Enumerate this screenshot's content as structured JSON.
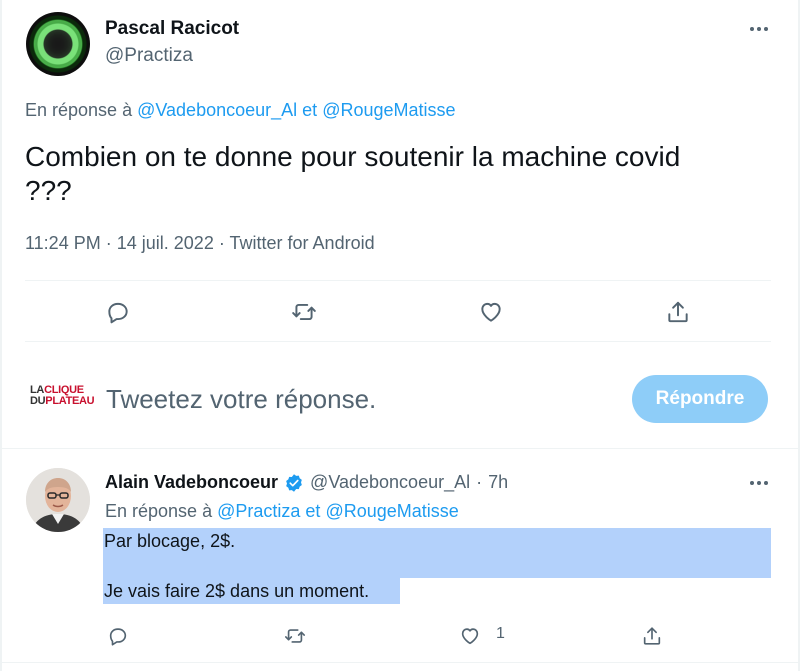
{
  "main_tweet": {
    "author_name": "Pascal Racicot",
    "author_handle": "@Practiza",
    "reply_prefix": "En réponse à",
    "reply_mentions": [
      "@Vadeboncoeur_Al",
      "@RougeMatisse"
    ],
    "reply_joiner": "et",
    "text_line1": "Combien on te donne pour soutenir la machine covid",
    "text_line2": "???",
    "time": "11:24 PM",
    "date": "14 juil. 2022",
    "source": "Twitter for Android",
    "separator": "·",
    "actions": [
      "reply-icon",
      "retweet-icon",
      "like-icon",
      "share-icon"
    ]
  },
  "compose": {
    "logo_line1_a": "LA",
    "logo_line1_b": "CLIQUE",
    "logo_line2_a": "DU",
    "logo_line2_b": "PLATEAU",
    "placeholder": "Tweetez votre réponse.",
    "reply_button": "Répondre"
  },
  "reply_tweet": {
    "author_name": "Alain Vadeboncoeur",
    "author_handle": "@Vadeboncoeur_Al",
    "separator": "·",
    "time_ago": "7h",
    "reply_prefix": "En réponse à",
    "reply_mentions": [
      "@Practiza",
      "@RougeMatisse"
    ],
    "reply_joiner": "et",
    "text_line1": "Par blocage, 2$.",
    "text_line2": "Je vais faire 2$ dans un moment.",
    "like_count": "1"
  },
  "colors": {
    "accent": "#1d9bf0",
    "secondary_text": "#536471",
    "button_disabled": "#8ecdf8",
    "selection": "#b3d1fb"
  }
}
